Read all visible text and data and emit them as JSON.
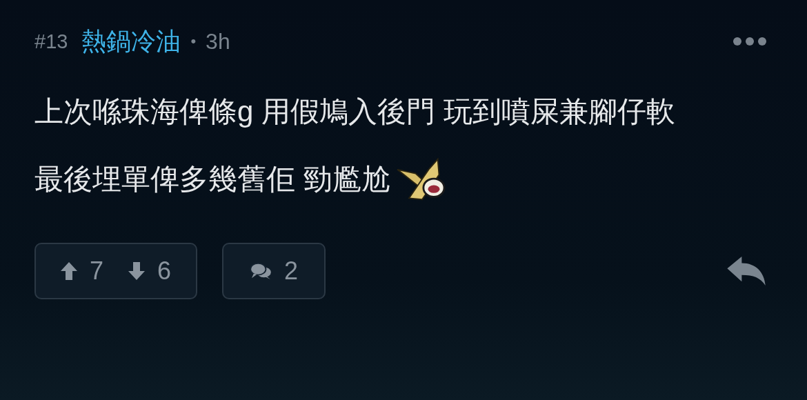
{
  "post": {
    "number": "#13",
    "author": "熱鍋冷油",
    "separator": "•",
    "time": "3h"
  },
  "body": [
    "上次喺珠海俾條g 用假鳩入後門 玩到噴屎兼腳仔軟",
    "最後埋單俾多幾舊佢 勁尷尬"
  ],
  "actions": {
    "upvotes": "7",
    "downvotes": "6",
    "comments": "2"
  }
}
